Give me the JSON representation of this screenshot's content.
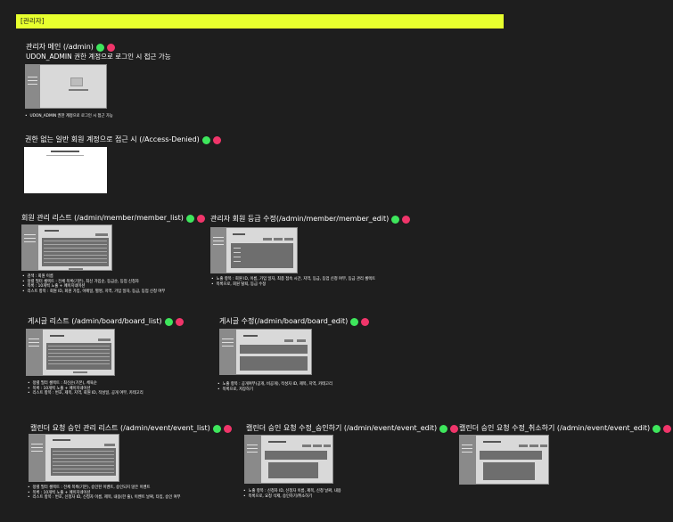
{
  "header": {
    "label": "[관리자]"
  },
  "sections": {
    "admin_main": {
      "title": "관리자 메인 (/admin)",
      "subtitle": "UDON_ADMIN 권한 계정으로 로그인 시 접근 가능",
      "notes": [
        "UDON_ADMIN 권한 계정으로 로그인 시 접근 가능"
      ]
    },
    "access_denied": {
      "title": "권한 없는 일반 회원 계정으로 접근 시 (/Access-Denied)"
    },
    "member_list": {
      "title": "회원 관리 리스트 (/admin/member/member_list)",
      "notes": [
        "검색 : 회원 이름",
        "정렬 필터 셀렉트 : 전체 목록(기본), 최신 가입순, 등급순, 등업 신청자",
        "목록 : 10개씩 노출 + 페이지네이션",
        "리스트 항목 : 회원 ID, 회원 가입, 이메일, 별명, 지역, 가입 일자, 등급, 등업 신청 여부"
      ]
    },
    "member_edit": {
      "title": "관리자 회원 등급 수정(/admin/member/member_edit)",
      "notes": [
        "노출 항목 : 회원 ID, 이름, 가입 일자, 최종 접속 시간, 지역, 등급, 등업 신청 여부, 등급 관리 셀렉트",
        "목록으로, 회원 탈퇴, 등급 수정"
      ]
    },
    "board_list": {
      "title": "게시글 리스트 (/admin/board/board_list)",
      "notes": [
        "정렬 필터 셀렉트 : 최신순(기본), 체육순",
        "목록 : 10개씩 노출 + 페이지네이션",
        "리스트 항목 : 번호, 제목, 지역, 회원 ID, 작성일, 공개 여부, 카테고리"
      ]
    },
    "board_edit": {
      "title": "게시글 수정(/admin/board/board_edit)",
      "notes": [
        "노출 항목 : 공개여부(공개, 비공개), 작성자 ID, 제목, 지역, 카테고리",
        "목록으로, 저장하기"
      ]
    },
    "event_list": {
      "title": "캘린더 요청 승인 관리 리스트 (/admin/event/event_list)",
      "notes": [
        "정렬 필터 셀렉트 : 전체 목록(기본), 승인된 이벤트, 승인되지 않은 이벤트",
        "목록 : 10개씩 노출 + 페이지네이션",
        "리스트 항목 : 번호, 신청자 ID, 신청자 이름, 제목, 내용(한 줄), 이벤트 날짜, 타입, 승인 여부"
      ]
    },
    "event_edit_approve": {
      "title": "캘린더 승인 요청 수정_승인하기 (/admin/event/event_edit)",
      "notes": [
        "노출 항목 : 신청자 ID, 신청자 이름, 제목, 신청 날짜, 내용",
        "목록으로, 요청 삭제, 승인하기/취소하기"
      ]
    },
    "event_edit_cancel": {
      "title": "캘린더 승인 요청 수정_취소하기 (/admin/event/event_edit)"
    }
  },
  "colors": {
    "header": "#e7ff2e",
    "background": "#1e1e1e",
    "status_green": "#3ee65c",
    "status_pink": "#f0356a"
  }
}
